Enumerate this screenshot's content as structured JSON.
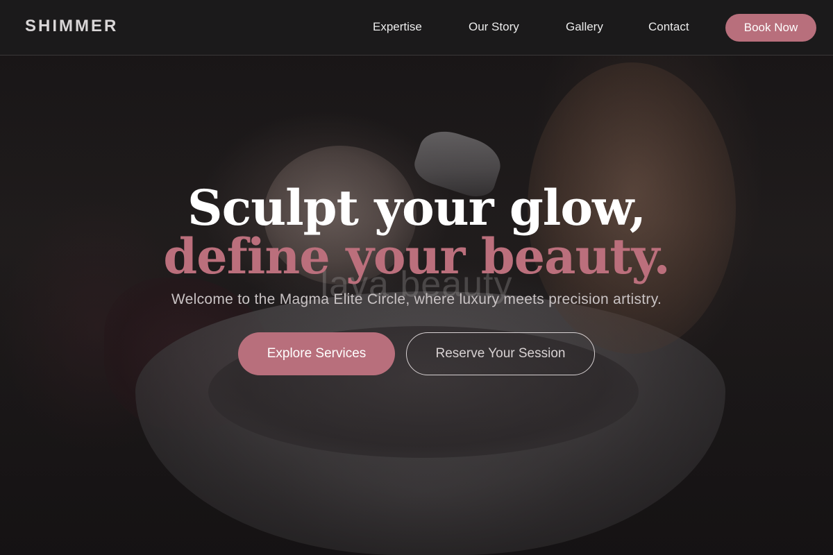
{
  "brand": {
    "logo": "SHIMMER"
  },
  "nav": {
    "links": [
      "Expertise",
      "Our Story",
      "Gallery",
      "Contact"
    ],
    "cta": "Book Now"
  },
  "hero": {
    "headline_line1": "Sculpt your glow,",
    "headline_line2": "define your beauty.",
    "watermark": "lava beauty",
    "subtitle": "Welcome to the Magma Elite Circle, where luxury meets precision artistry.",
    "primary_button": "Explore Services",
    "secondary_button": "Reserve Your Session"
  },
  "colors": {
    "accent": "#b86f7c",
    "header_bg": "#1b1a1b",
    "text_light": "#ececec"
  }
}
